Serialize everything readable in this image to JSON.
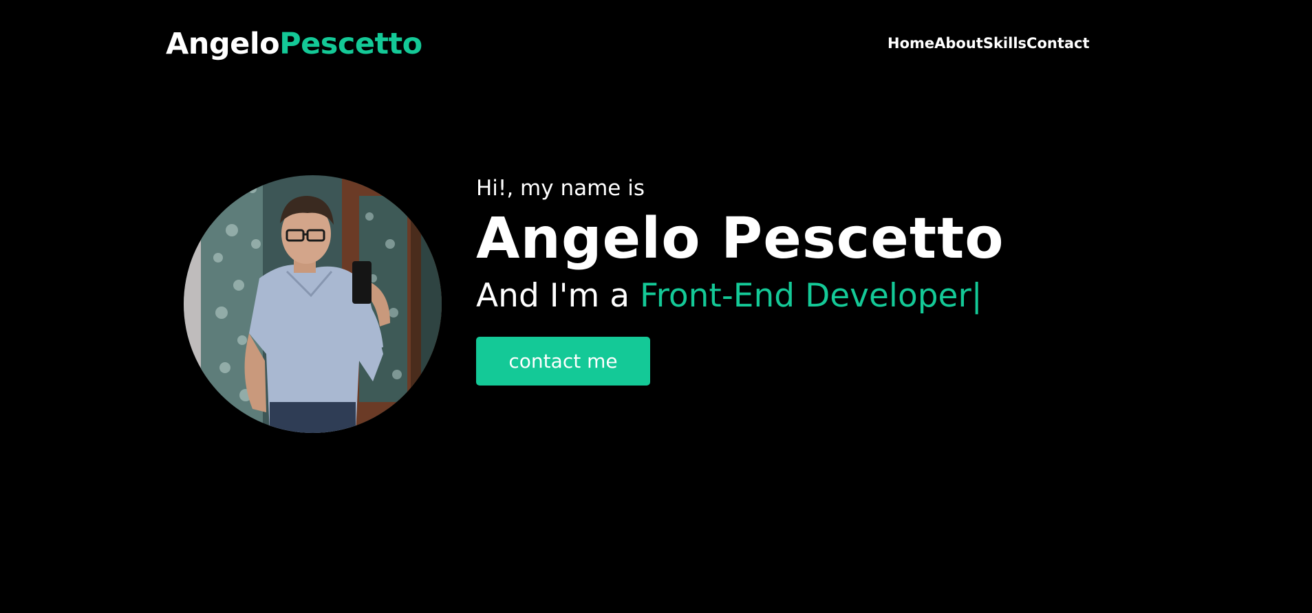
{
  "header": {
    "logo_first": "Angelo",
    "logo_last": "Pescetto",
    "nav": [
      {
        "label": "Home"
      },
      {
        "label": "About"
      },
      {
        "label": "Skills"
      },
      {
        "label": "Contact"
      }
    ]
  },
  "hero": {
    "greeting": "Hi!, my name is",
    "name": "Angelo Pescetto",
    "role_prefix": "And I'm a ",
    "role": "Front-End Developer",
    "cursor": "|",
    "button_label": "contact me"
  },
  "colors": {
    "background": "#000000",
    "accent": "#14c997",
    "text": "#ffffff"
  }
}
